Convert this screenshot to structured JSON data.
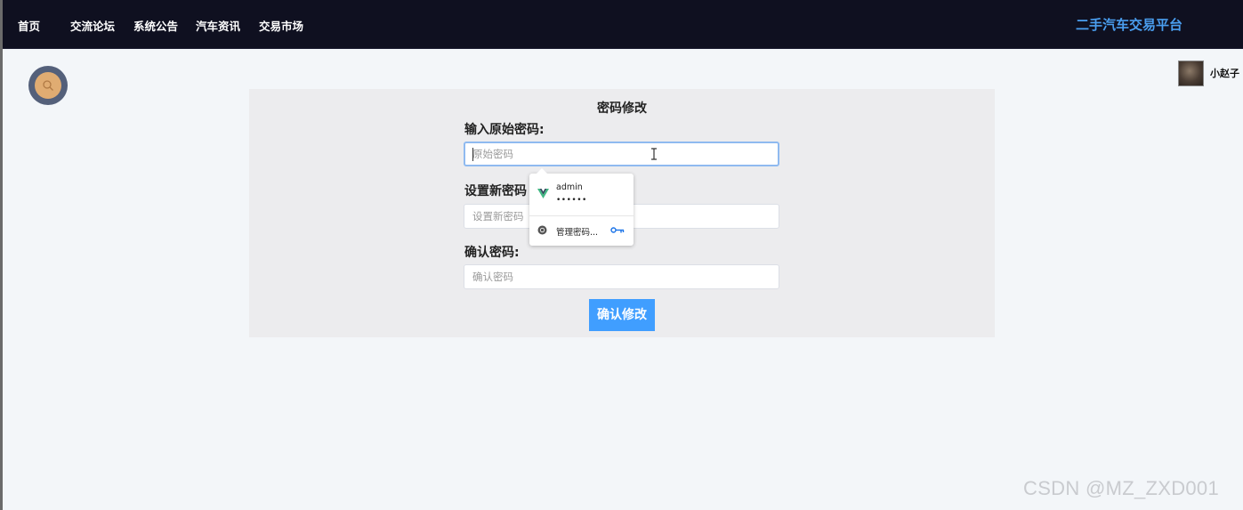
{
  "nav": {
    "items": [
      {
        "label": "首页"
      },
      {
        "label": "交流论坛"
      },
      {
        "label": "系统公告"
      },
      {
        "label": "汽车资讯"
      },
      {
        "label": "交易市场"
      }
    ],
    "brand": "二手汽车交易平台"
  },
  "search": {
    "icon": "search-icon"
  },
  "user": {
    "name": "小赵子"
  },
  "form": {
    "title": "密码修改",
    "old_password": {
      "label": "输入原始密码:",
      "placeholder": "原始密码"
    },
    "new_password": {
      "label": "设置新密码",
      "placeholder": "设置新密码"
    },
    "confirm_password": {
      "label": "确认密码:",
      "placeholder": "确认密码"
    },
    "submit": "确认修改"
  },
  "autofill_popup": {
    "username": "admin",
    "password_mask": "••••••",
    "manage_label": "管理密码..."
  },
  "watermark": "CSDN @MZ_ZXD001",
  "colors": {
    "nav_bg": "#0f1020",
    "brand": "#4a9eef",
    "accent": "#409eff",
    "search_outer": "#54607a",
    "search_inner": "#e0ac72"
  }
}
